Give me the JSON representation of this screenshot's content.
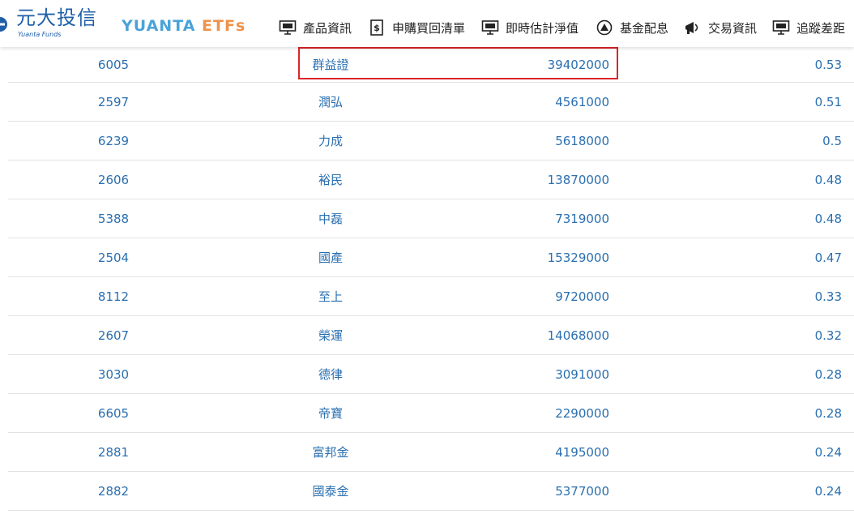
{
  "brand": {
    "name_cn": "元大投信",
    "name_en": "Yuanta Funds",
    "etf_logo_a": "YUANTA",
    "etf_logo_b": "ETFs"
  },
  "nav": [
    {
      "label": "產品資訊",
      "icon": "monitor-icon"
    },
    {
      "label": "申購買回清單",
      "icon": "dollar-doc-icon"
    },
    {
      "label": "即時估計淨值",
      "icon": "monitor-icon"
    },
    {
      "label": "基金配息",
      "icon": "coins-icon"
    },
    {
      "label": "交易資訊",
      "icon": "megaphone-icon"
    },
    {
      "label": "追蹤差距",
      "icon": "monitor-icon"
    }
  ],
  "colors": {
    "brand_blue": "#1f5fa8",
    "etf_blue": "#4aa3d8",
    "etf_orange": "#f0924a",
    "link_blue": "#2a6fb0",
    "highlight_red": "#d9262b"
  },
  "holdings": [
    {
      "code": "6005",
      "name": "群益證",
      "shares": "39402000",
      "weight": "0.53"
    },
    {
      "code": "2597",
      "name": "潤弘",
      "shares": "4561000",
      "weight": "0.51"
    },
    {
      "code": "6239",
      "name": "力成",
      "shares": "5618000",
      "weight": "0.5"
    },
    {
      "code": "2606",
      "name": "裕民",
      "shares": "13870000",
      "weight": "0.48"
    },
    {
      "code": "5388",
      "name": "中磊",
      "shares": "7319000",
      "weight": "0.48"
    },
    {
      "code": "2504",
      "name": "國產",
      "shares": "15329000",
      "weight": "0.47"
    },
    {
      "code": "8112",
      "name": "至上",
      "shares": "9720000",
      "weight": "0.33"
    },
    {
      "code": "2607",
      "name": "榮運",
      "shares": "14068000",
      "weight": "0.32"
    },
    {
      "code": "3030",
      "name": "德律",
      "shares": "3091000",
      "weight": "0.28"
    },
    {
      "code": "6605",
      "name": "帝寶",
      "shares": "2290000",
      "weight": "0.28"
    },
    {
      "code": "2881",
      "name": "富邦金",
      "shares": "4195000",
      "weight": "0.24"
    },
    {
      "code": "2882",
      "name": "國泰金",
      "shares": "5377000",
      "weight": "0.24"
    }
  ]
}
